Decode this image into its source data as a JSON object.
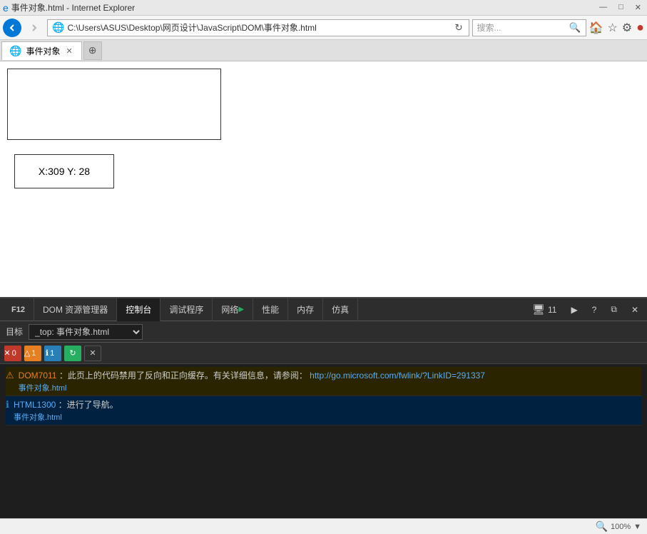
{
  "titlebar": {
    "minimize": "—",
    "maximize": "□",
    "close": "✕"
  },
  "navbar": {
    "address": "C:\\Users\\ASUS\\Desktop\\网页设计\\JavaScript\\DOM\\事件对象.html",
    "search_placeholder": "搜索...",
    "refresh_title": "刷新"
  },
  "tabs": [
    {
      "label": "事件对象",
      "icon": "🌐"
    }
  ],
  "page": {
    "coords_text": "X:309 Y: 28"
  },
  "devtools": {
    "tabs": [
      {
        "label": "F12",
        "id": "f12"
      },
      {
        "label": "DOM 资源管理器",
        "id": "dom"
      },
      {
        "label": "控制台",
        "id": "console",
        "active": true
      },
      {
        "label": "调试程序",
        "id": "debugger"
      },
      {
        "label": "网络",
        "id": "network"
      },
      {
        "label": "性能",
        "id": "performance"
      },
      {
        "label": "内存",
        "id": "memory"
      },
      {
        "label": "仿真",
        "id": "emulation"
      }
    ],
    "right_buttons": [
      {
        "label": "11",
        "icon": "🖥"
      },
      {
        "label": "▶",
        "id": "run"
      },
      {
        "label": "?",
        "id": "help"
      },
      {
        "label": "⧉",
        "id": "dock"
      },
      {
        "label": "✕",
        "id": "close"
      }
    ],
    "target_label": "目标",
    "target_value": "_top: 事件对象.html",
    "action_buttons": [
      {
        "type": "error",
        "icon": "✕",
        "count": "0"
      },
      {
        "type": "warning",
        "icon": "△",
        "count": "1"
      },
      {
        "type": "info",
        "icon": "ℹ",
        "count": "1"
      },
      {
        "type": "info2",
        "icon": "↻",
        "count": ""
      },
      {
        "type": "clear",
        "icon": "✕",
        "count": ""
      }
    ],
    "logs": [
      {
        "type": "warning",
        "icon": "⚠",
        "icon_color": "#e67e22",
        "code": "DOM7011",
        "text_before": "此页上的代码禁用了反向和正向缓存。有关详细信息，请参阅：",
        "link_text": "http://go.microsoft.com/fwlink/?LinkID=291337",
        "link_href": "http://go.microsoft.com/fwlink/?LinkID=291337",
        "source": "事件对象.html"
      },
      {
        "type": "info",
        "icon": "ℹ",
        "icon_color": "#2980b9",
        "code": "HTML1300",
        "text_before": "进行了导航。",
        "link_text": "",
        "link_href": "",
        "source": "事件对象.html"
      }
    ]
  },
  "statusbar": {
    "zoom_label": "100%"
  }
}
